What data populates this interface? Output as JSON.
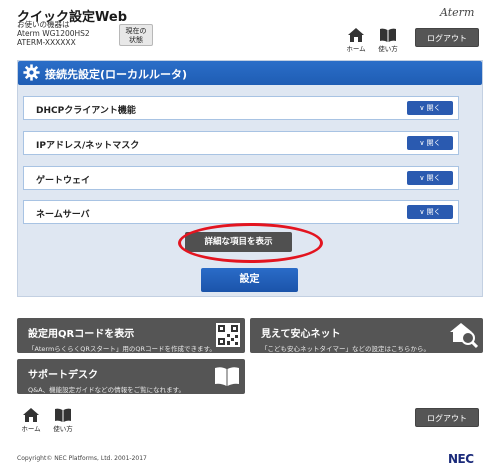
{
  "header": {
    "app_title": "クイック設定Web",
    "device_lines": [
      "お使いの機器は",
      "Aterm WG1200HS2",
      "ATERM-XXXXXX"
    ],
    "status_button": [
      "現在の",
      "状態"
    ],
    "brand": "Aterm",
    "home_label": "ホーム",
    "help_label": "使い方",
    "logout_label": "ログアウト"
  },
  "panel": {
    "title": "接続先設定(ローカルルータ)",
    "sections": [
      {
        "label": "DHCPクライアント機能",
        "button": "開く"
      },
      {
        "label": "IPアドレス/ネットマスク",
        "button": "開く"
      },
      {
        "label": "ゲートウェイ",
        "button": "開く"
      },
      {
        "label": "ネームサーバ",
        "button": "開く"
      }
    ],
    "detail_button": "詳細な項目を表示",
    "settings_button": "設定"
  },
  "tiles": {
    "qr": {
      "title": "設定用QRコードを表示",
      "desc": "「AtermらくらくQRスタート」用のQRコードを作成できます。"
    },
    "safety": {
      "title": "見えて安心ネット",
      "desc": "「こども安心ネットタイマー」などの設定はこちらから。"
    },
    "support": {
      "title": "サポートデスク",
      "desc": "Q&A、機能設定ガイドなどの情報をご覧になれます。"
    }
  },
  "footer": {
    "home_label": "ホーム",
    "help_label": "使い方",
    "logout_label": "ログアウト",
    "copyright": "Copyright© NEC Platforms, Ltd. 2001-2017",
    "logo": "NEC"
  },
  "colors": {
    "accent_blue": "#1f5db4",
    "panel_bg": "#dfe7f2",
    "tile_dark": "#555555",
    "highlight_red": "#e3141f"
  }
}
